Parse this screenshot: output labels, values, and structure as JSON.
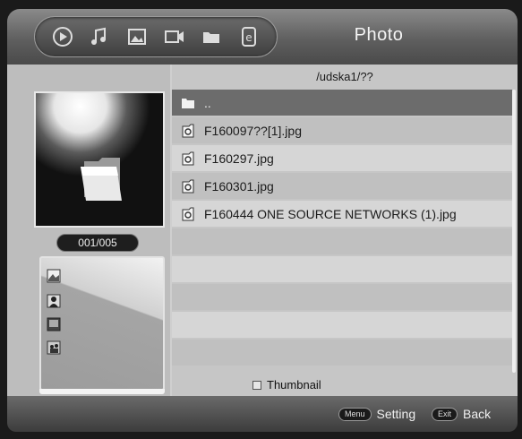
{
  "header": {
    "title": "Photo",
    "icons": [
      "play-icon",
      "music-icon",
      "photo-icon",
      "video-icon",
      "folder-icon",
      "ebook-icon"
    ]
  },
  "path": "/udska1/??",
  "preview": {
    "counter": "001/005"
  },
  "files": [
    {
      "name": "..",
      "type": "folder",
      "selected": true
    },
    {
      "name": "F160097??[1].jpg",
      "type": "image"
    },
    {
      "name": "F160297.jpg",
      "type": "image"
    },
    {
      "name": "F160301.jpg",
      "type": "image"
    },
    {
      "name": "F160444 ONE SOURCE NETWORKS (1).jpg",
      "type": "image"
    },
    {
      "name": "",
      "type": "empty"
    },
    {
      "name": "",
      "type": "empty"
    },
    {
      "name": "",
      "type": "empty"
    },
    {
      "name": "",
      "type": "empty"
    },
    {
      "name": "",
      "type": "empty"
    }
  ],
  "thumbnail_option": {
    "label": "Thumbnail",
    "checked": false
  },
  "footer": {
    "setting": {
      "key": "Menu",
      "label": "Setting"
    },
    "back": {
      "key": "Exit",
      "label": "Back"
    }
  },
  "colors": {
    "selected_row": "#6c6c6c",
    "header": "#5f5f5f"
  }
}
